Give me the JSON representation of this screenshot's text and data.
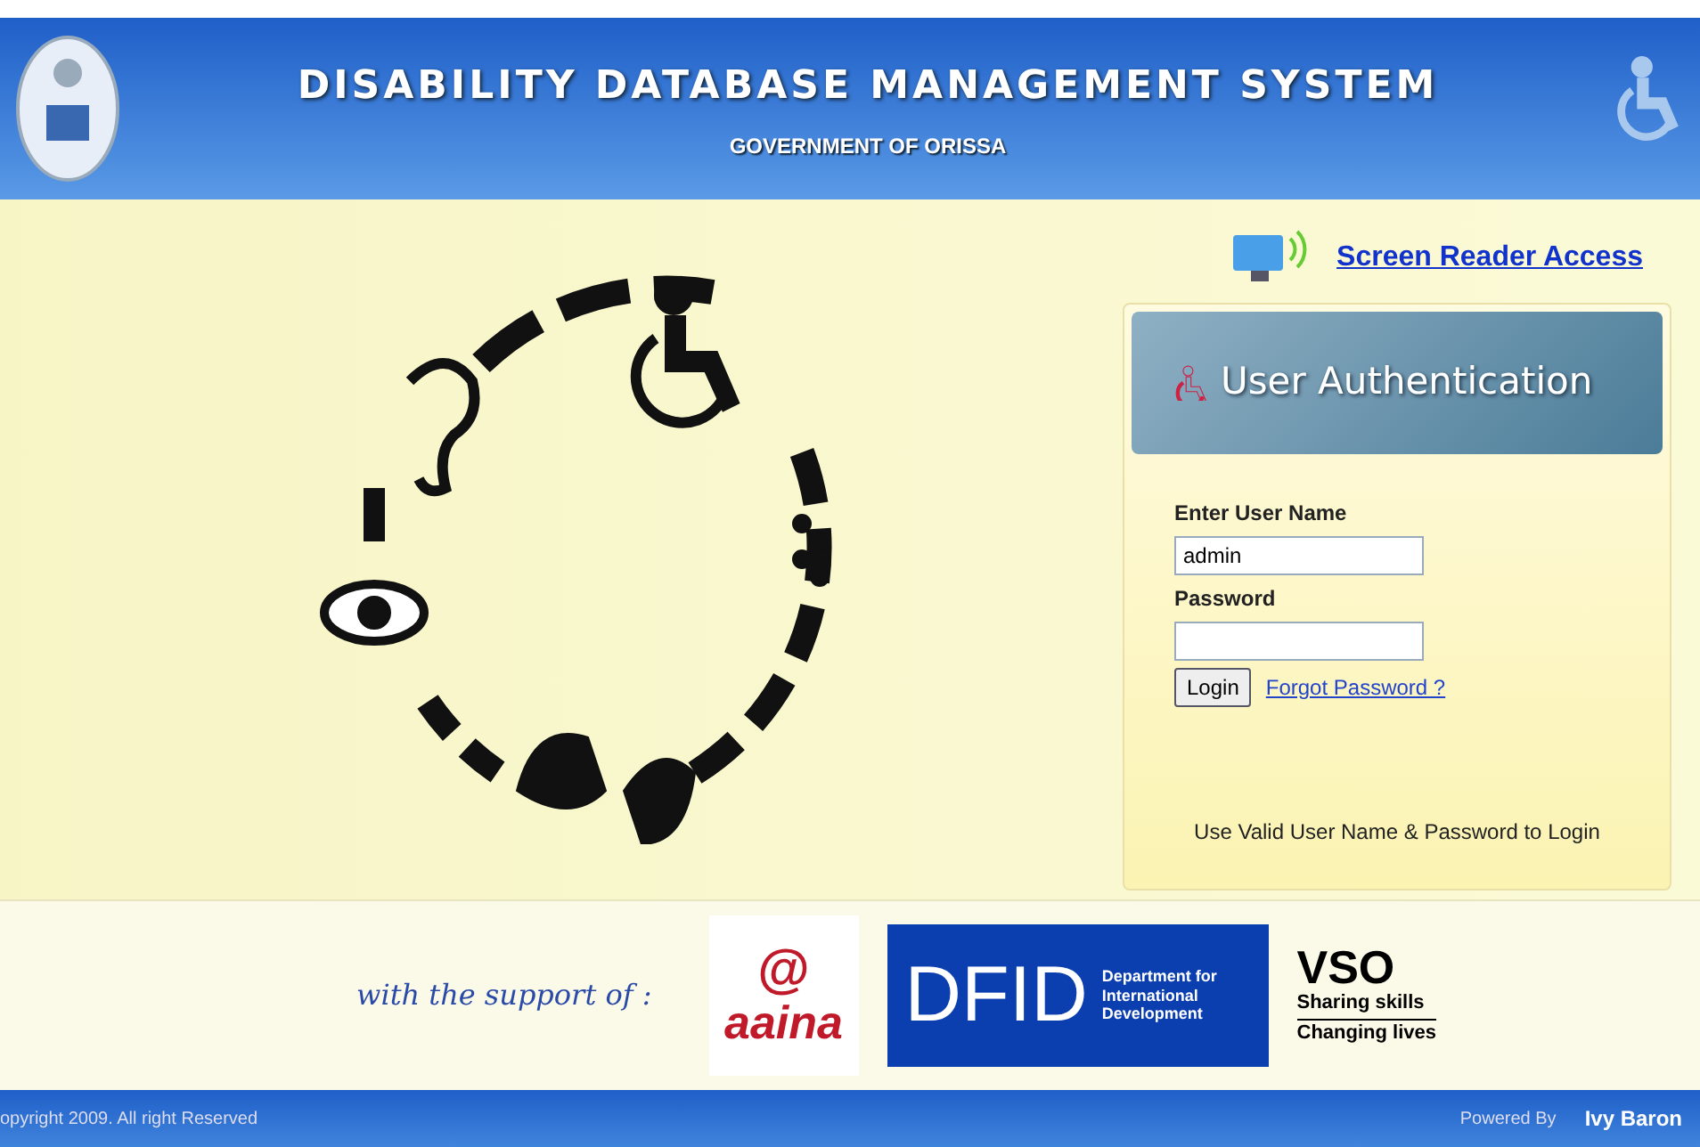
{
  "header": {
    "title": "DISABILITY DATABASE MANAGEMENT SYSTEM",
    "subtitle": "GOVERNMENT OF ORISSA"
  },
  "screen_reader_link": "Screen Reader Access",
  "auth_panel": {
    "title": "User Authentication",
    "username_label": "Enter User Name",
    "username_value": "admin",
    "password_label": "Password",
    "login_button": "Login",
    "forgot_link": "Forgot Password ?",
    "hint": "Use Valid User Name & Password to Login"
  },
  "support": {
    "label": "with the support of :",
    "aaina": {
      "mark": "@",
      "name": "aaina"
    },
    "dfid": {
      "name": "DFID",
      "lines": [
        "Department for",
        "International",
        "Development"
      ]
    },
    "vso": {
      "name": "VSO",
      "lines": [
        "Sharing skills",
        "Changing lives"
      ]
    }
  },
  "footer": {
    "copyright": "opyright 2009. All right Reserved",
    "powered_label": "Powered By",
    "powered_name": "Ivy Baron"
  }
}
